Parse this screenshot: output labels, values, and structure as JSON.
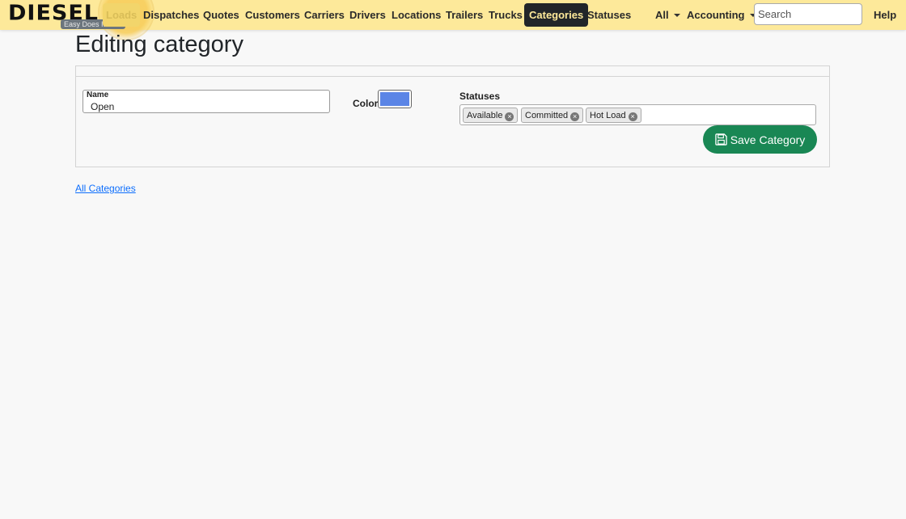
{
  "brand": {
    "name": "DIESEL",
    "tagline": "Easy Does It Tech"
  },
  "nav": {
    "items": [
      {
        "label": "Loads"
      },
      {
        "label": "Dispatches"
      },
      {
        "label": "Quotes"
      },
      {
        "label": "Customers"
      },
      {
        "label": "Carriers"
      },
      {
        "label": "Drivers"
      },
      {
        "label": "Locations"
      },
      {
        "label": "Trailers"
      },
      {
        "label": "Trucks"
      },
      {
        "label": "Categories",
        "active": true
      },
      {
        "label": "Statuses"
      }
    ],
    "dropdowns": [
      {
        "label": "All"
      },
      {
        "label": "Accounting"
      }
    ],
    "search_placeholder": "Search",
    "help_label": "Help"
  },
  "page": {
    "title": "Editing category"
  },
  "form": {
    "name_label": "Name",
    "name_value": "Open",
    "color_label": "Color",
    "color_value": "#5b85e6",
    "statuses_label": "Statuses",
    "statuses": [
      {
        "label": "Available"
      },
      {
        "label": "Committed"
      },
      {
        "label": "Hot Load"
      }
    ],
    "save_label": "Save Category"
  },
  "links": {
    "all_categories": "All Categories"
  },
  "colors": {
    "navbar_bg": "#fde99a",
    "active_bg": "#212529",
    "save_button": "#198754",
    "link": "#0d6efd"
  }
}
